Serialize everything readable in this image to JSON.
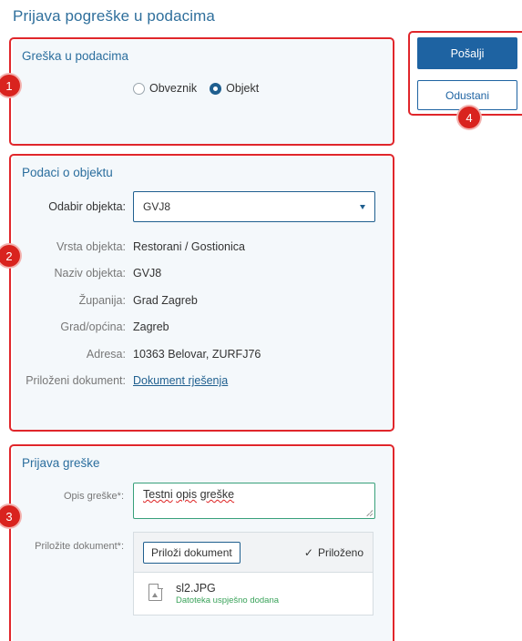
{
  "page_title": "Prijava pogreške u podacima",
  "section1": {
    "title": "Greška u podacima",
    "radio_options": [
      "Obveznik",
      "Objekt"
    ],
    "selected": "Objekt"
  },
  "section2": {
    "title": "Podaci o objektu",
    "select_label": "Odabir objekta:",
    "select_value": "GVJ8",
    "rows": [
      {
        "label": "Vrsta objekta:",
        "value": "Restorani / Gostionica"
      },
      {
        "label": "Naziv objekta:",
        "value": "GVJ8"
      },
      {
        "label": "Županija:",
        "value": "Grad Zagreb"
      },
      {
        "label": "Grad/općina:",
        "value": "Zagreb"
      },
      {
        "label": "Adresa:",
        "value": "10363 Belovar, ZURFJ76"
      },
      {
        "label": "Priloženi dokument:",
        "value": "Dokument rješenja"
      }
    ]
  },
  "section3": {
    "title": "Prijava greške",
    "desc_label": "Opis greške*:",
    "desc_value_word1": "Testni",
    "desc_value_word2": "opis",
    "desc_value_word3": "greške",
    "attach_label": "Priložite dokument*:",
    "attach_button": "Priloži dokument",
    "attached_check": "✓",
    "attached_text": "Priloženo",
    "file_name": "sl2.JPG",
    "file_status": "Datoteka uspješno dodana"
  },
  "actions": {
    "send": "Pošalji",
    "cancel": "Odustani"
  },
  "markers": [
    "1",
    "2",
    "3",
    "4"
  ],
  "colors": {
    "accent": "#1e63a2",
    "title": "#2f6f9c",
    "annotation_red": "#e0262b",
    "success": "#3aa35a"
  }
}
